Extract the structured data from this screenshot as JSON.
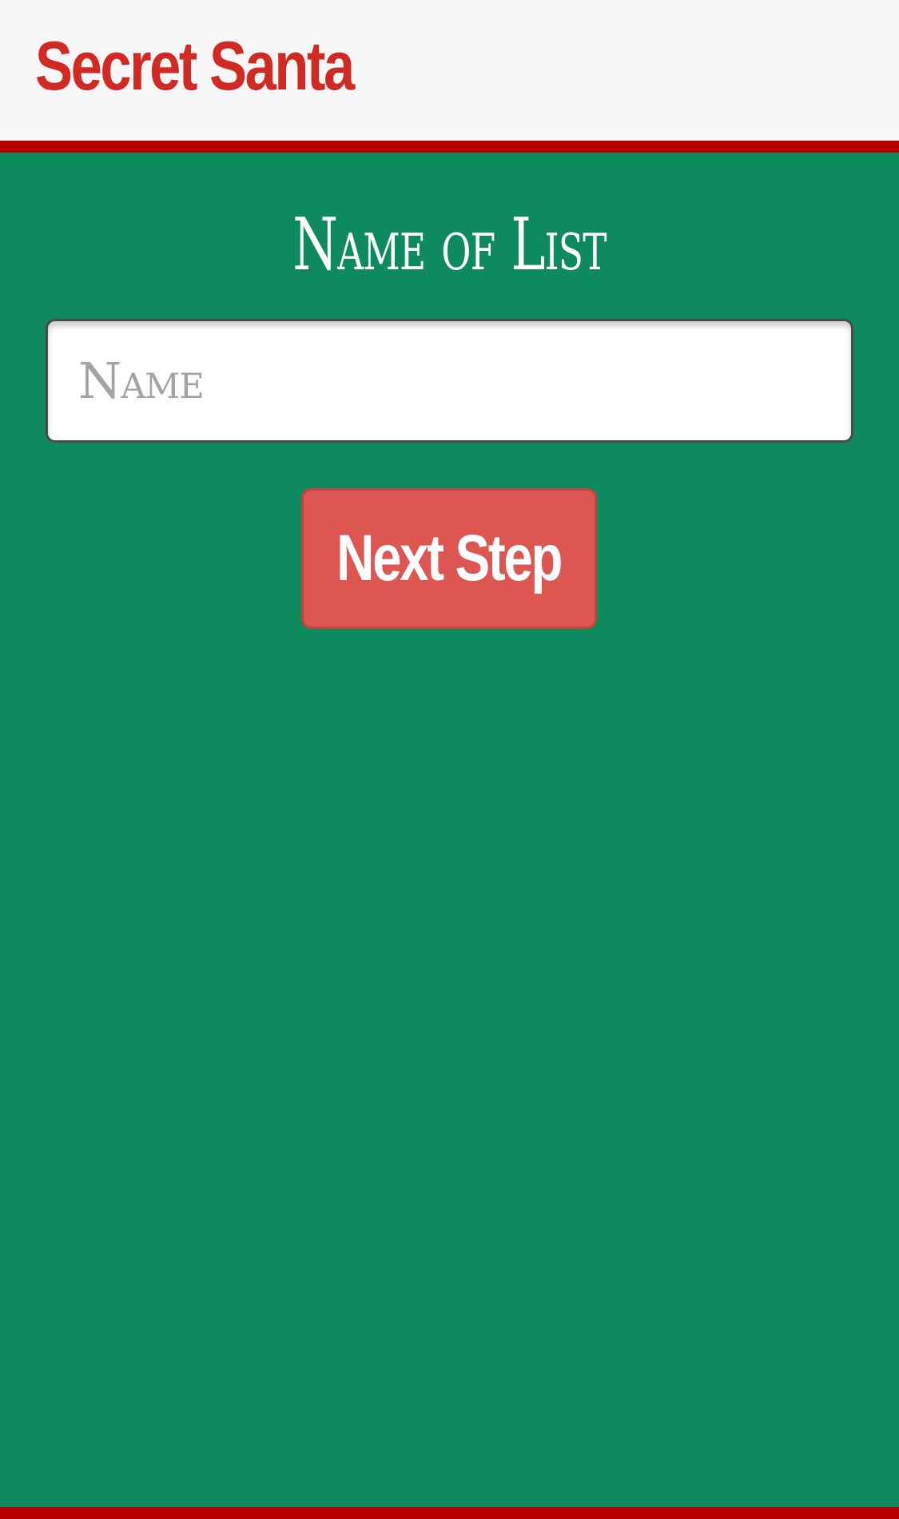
{
  "header": {
    "app_title": "Secret Santa"
  },
  "form": {
    "heading": "Name of List",
    "name_input": {
      "value": "",
      "placeholder": "Name"
    },
    "next_button_label": "Next Step"
  },
  "colors": {
    "header_background": "#f7f7f7",
    "brand_red": "#d12a24",
    "accent_bar": "#b70000",
    "page_background": "#0d8a5e",
    "button_background": "#dd5652"
  }
}
